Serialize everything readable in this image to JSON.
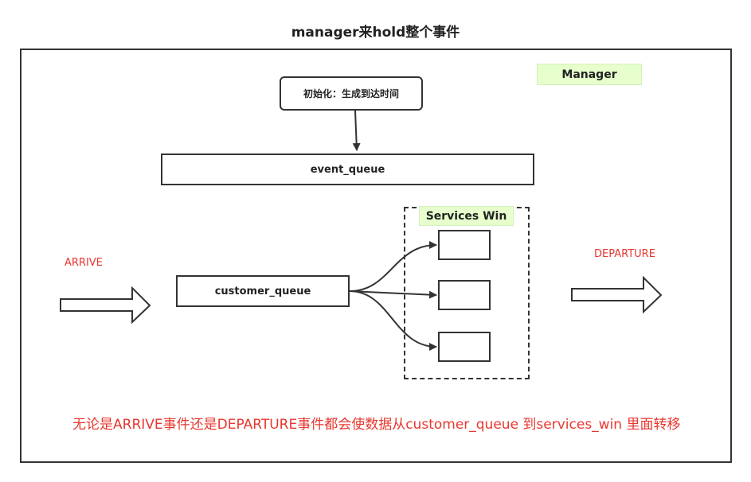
{
  "title": "manager来hold整个事件",
  "manager_label": "Manager",
  "init_box": "初始化：生成到达时间",
  "event_queue": "event_queue",
  "customer_queue": "customer_queue",
  "services_win": "Services Win",
  "arrive": "ARRIVE",
  "departure": "DEPARTURE",
  "note": "无论是ARRIVE事件还是DEPARTURE事件都会使数据从customer_queue 到services_win 里面转移",
  "colors": {
    "accent_red": "#e8372f",
    "label_green": "#e6ffcc",
    "stroke": "#333333"
  }
}
